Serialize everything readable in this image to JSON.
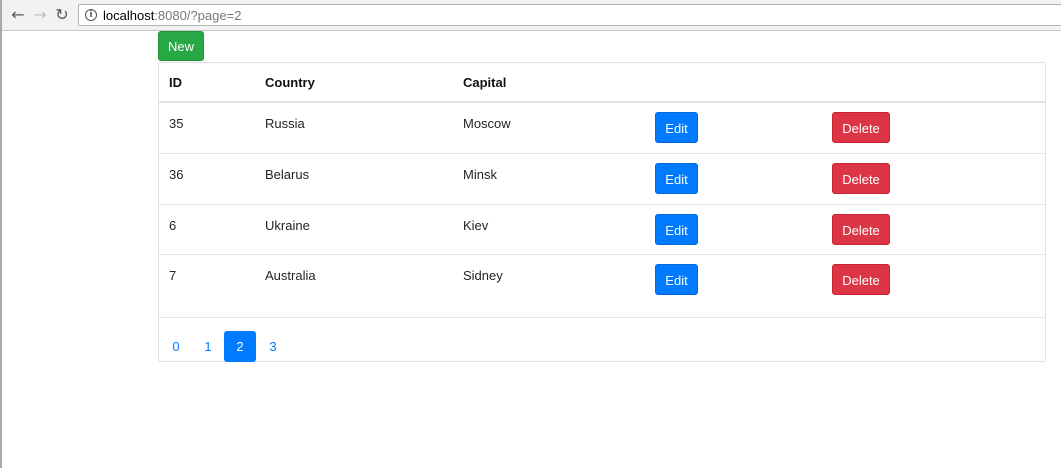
{
  "browser": {
    "url_host": "localhost",
    "url_rest": ":8080/?page=2",
    "back_icon": "arrow-left-icon",
    "forward_icon": "arrow-right-icon",
    "reload_icon": "reload-icon",
    "info_icon": "info-icon"
  },
  "page": {
    "new_button": "New",
    "table": {
      "headers": [
        "ID",
        "Country",
        "Capital"
      ],
      "rows": [
        {
          "id": "35",
          "country": "Russia",
          "capital": "Moscow",
          "edit": "Edit",
          "delete": "Delete"
        },
        {
          "id": "36",
          "country": "Belarus",
          "capital": "Minsk",
          "edit": "Edit",
          "delete": "Delete"
        },
        {
          "id": "6",
          "country": "Ukraine",
          "capital": "Kiev",
          "edit": "Edit",
          "delete": "Delete"
        },
        {
          "id": "7",
          "country": "Australia",
          "capital": "Sidney",
          "edit": "Edit",
          "delete": "Delete"
        }
      ]
    },
    "pagination": {
      "pages": [
        "0",
        "1",
        "2",
        "3"
      ],
      "active": "2"
    }
  },
  "colors": {
    "success": "#28a745",
    "primary": "#007bff",
    "danger": "#dc3545"
  }
}
